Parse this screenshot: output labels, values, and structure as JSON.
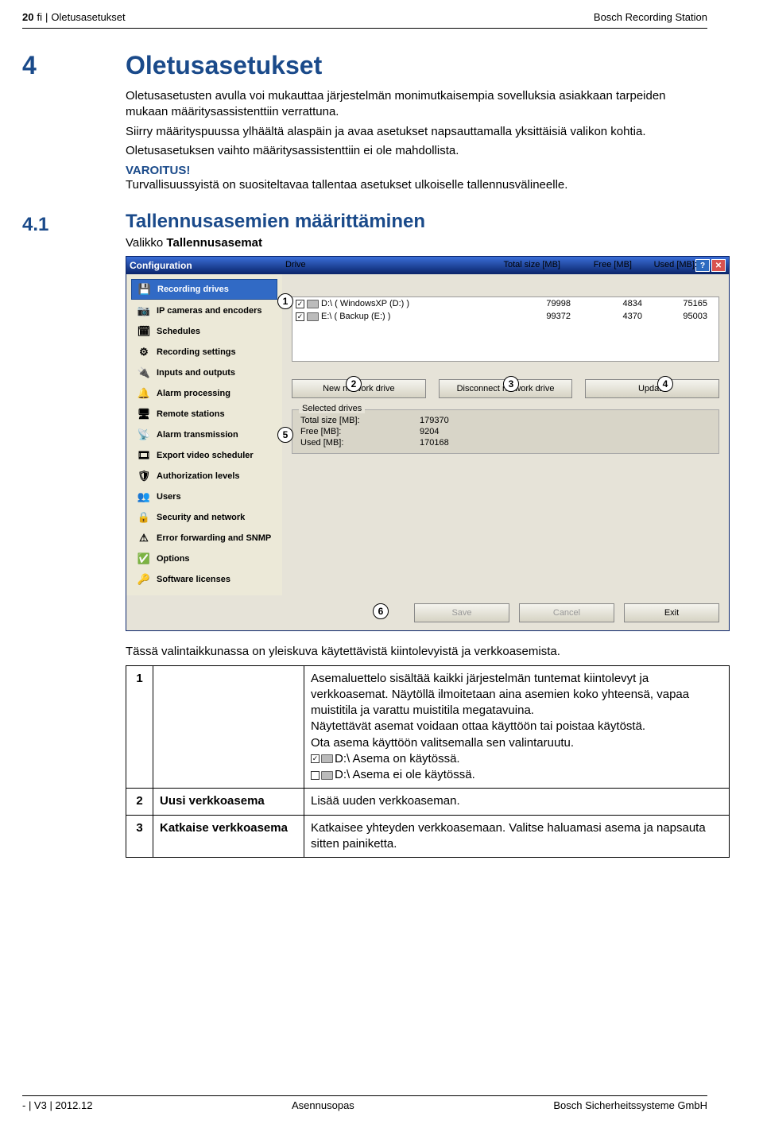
{
  "header": {
    "page": "20",
    "lang": "fi",
    "breadcrumb": "Oletusasetukset",
    "product": "Bosch Recording Station"
  },
  "section": {
    "num": "4",
    "title": "Oletusasetukset",
    "p1": "Oletusasetusten avulla voi mukauttaa järjestelmän monimutkaisempia sovelluksia asiakkaan tarpeiden mukaan määritysassistenttiin verrattuna.",
    "p2": "Siirry määrityspuussa ylhäältä alaspäin ja avaa asetukset napsauttamalla yksittäisiä valikon kohtia.",
    "p3": "Oletusasetuksen vaihto määritysassistenttiin ei ole mahdollista.",
    "warn_label": "VAROITUS!",
    "warn_text": "Turvallisuussyistä on suositeltavaa tallentaa asetukset ulkoiselle tallennusvälineelle."
  },
  "subsection": {
    "num": "4.1",
    "title": "Tallennusasemien määrittäminen",
    "menu_prefix": "Valikko ",
    "menu_item": "Tallennusasemat"
  },
  "win": {
    "title": "Configuration",
    "nav": [
      "Recording drives",
      "IP cameras and encoders",
      "Schedules",
      "Recording settings",
      "Inputs and outputs",
      "Alarm processing",
      "Remote stations",
      "Alarm transmission",
      "Export video scheduler",
      "Authorization levels",
      "Users",
      "Security and network",
      "Error forwarding and SNMP",
      "Options",
      "Software licenses"
    ],
    "cols": {
      "drive": "Drive",
      "total": "Total size [MB]",
      "free": "Free [MB]",
      "used": "Used [MB]:"
    },
    "rows": [
      {
        "checked": true,
        "label": "D:\\ ( WindowsXP (D:) )",
        "total": "79998",
        "free": "4834",
        "used": "75165"
      },
      {
        "checked": true,
        "label": "E:\\ ( Backup (E:) )",
        "total": "99372",
        "free": "4370",
        "used": "95003"
      }
    ],
    "btn_new": "New network drive",
    "btn_disc": "Disconnect network drive",
    "btn_upd": "Update",
    "sel_legend": "Selected drives",
    "sel_rows": [
      {
        "l": "Total size [MB]:",
        "v": "179370"
      },
      {
        "l": "Free [MB]:",
        "v": "9204"
      },
      {
        "l": "Used [MB]:",
        "v": "170168"
      }
    ],
    "btn_save": "Save",
    "btn_cancel": "Cancel",
    "btn_exit": "Exit",
    "callouts": [
      "1",
      "2",
      "3",
      "4",
      "5",
      "6"
    ]
  },
  "caption": "Tässä valintaikkunassa on yleiskuva käytettävistä kiintolevyistä ja verkkoasemista.",
  "table": {
    "r1n": "1",
    "r1a": "Asemaluettelo sisältää kaikki järjestelmän tuntemat kiintolevyt ja verkkoasemat. Näytöllä ilmoitetaan aina asemien koko yhteensä, vapaa muistitila ja varattu muistitila megatavuina.",
    "r1b": "Näytettävät asemat voidaan ottaa käyttöön tai poistaa käytöstä.",
    "r1c": "Ota asema käyttöön valitsemalla sen valintaruutu.",
    "r1d_label": "D:\\",
    "r1d_on": " Asema on käytössä.",
    "r1e_label": "D:\\",
    "r1e_off": " Asema ei ole käytössä.",
    "r2n": "2",
    "r2l": "Uusi verkkoasema",
    "r2t": "Lisää uuden verkkoaseman.",
    "r3n": "3",
    "r3l": "Katkaise verkkoasema",
    "r3t": "Katkaisee yhteyden verkkoasemaan. Valitse haluamasi asema ja napsauta sitten painiketta."
  },
  "footer": {
    "left": "- | V3 | 2012.12",
    "center": "Asennusopas",
    "right": "Bosch Sicherheitssysteme GmbH"
  }
}
